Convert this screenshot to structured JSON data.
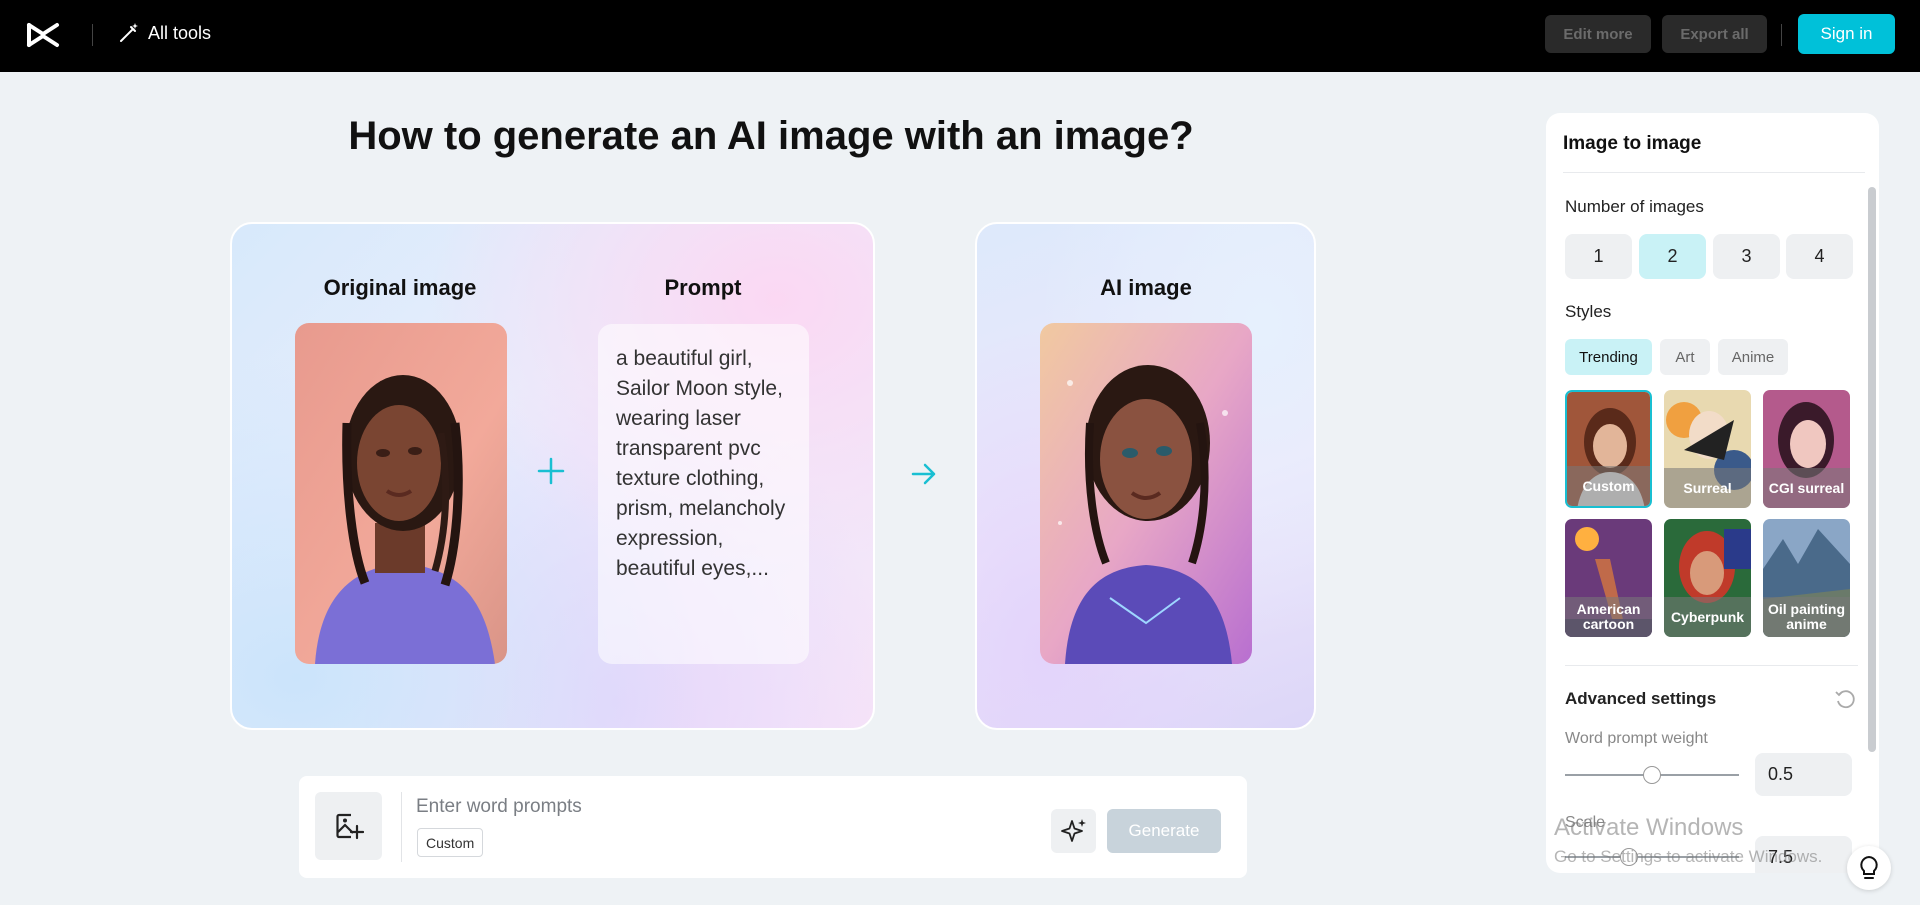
{
  "topbar": {
    "logo_icon": "capcut-logo-icon",
    "all_tools_label": "All tools",
    "edit_more_label": "Edit more",
    "export_all_label": "Export all",
    "sign_in_label": "Sign in",
    "accent_color": "#00c1d9"
  },
  "main": {
    "title": "How to generate an AI image with an image?",
    "original_image_title": "Original image",
    "prompt_title": "Prompt",
    "ai_image_title": "AI image",
    "prompt_text": "a beautiful girl, Sailor Moon style, wearing laser transparent pvc texture clothing, prism, melancholy expression, beautiful eyes,..."
  },
  "prompt_bar": {
    "input_placeholder": "Enter word prompts",
    "style_tag": "Custom",
    "generate_label": "Generate"
  },
  "panel": {
    "title": "Image to image",
    "number_of_images_label": "Number of images",
    "number_options": [
      "1",
      "2",
      "3",
      "4"
    ],
    "selected_number": "2",
    "styles_label": "Styles",
    "style_tabs": [
      "Trending",
      "Art",
      "Anime"
    ],
    "selected_tab": "Trending",
    "style_items": [
      {
        "label": "Custom",
        "selected": true
      },
      {
        "label": "Surreal",
        "selected": false
      },
      {
        "label": "CGI surreal",
        "selected": false
      },
      {
        "label": "American cartoon",
        "selected": false
      },
      {
        "label": "Cyberpunk",
        "selected": false
      },
      {
        "label": "Oil painting anime",
        "selected": false
      }
    ],
    "advanced_settings_label": "Advanced settings",
    "word_prompt_weight_label": "Word prompt weight",
    "word_prompt_weight_value": "0.5",
    "scale_label": "Scale",
    "scale_value": "7.5"
  },
  "watermark": {
    "line1": "Activate Windows",
    "line2": "Go to Settings to activate Windows."
  }
}
